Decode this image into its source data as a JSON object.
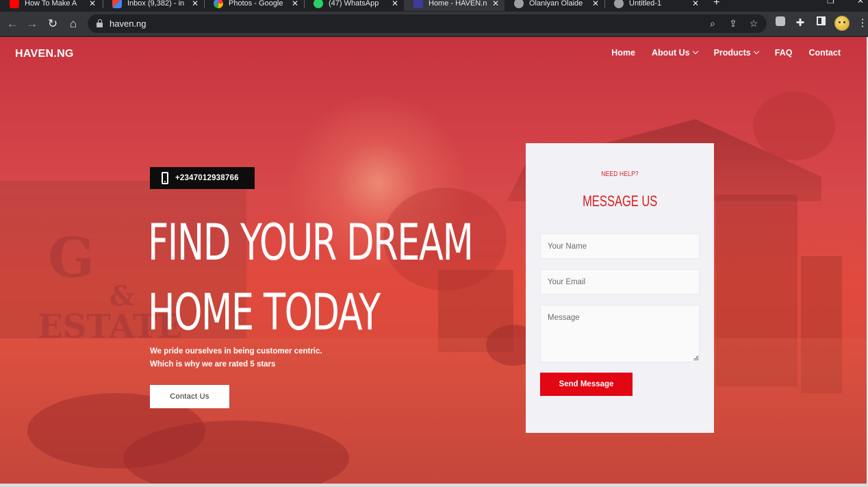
{
  "browser": {
    "tabs": [
      {
        "label": "How To Make A",
        "icon": "youtube-icon",
        "color": "#ff0000"
      },
      {
        "label": "Inbox (9,382) - in",
        "icon": "gmail-icon",
        "color": "#ea4335"
      },
      {
        "label": "Photos - Google",
        "icon": "google-photos-icon",
        "color": "#fbbc04"
      },
      {
        "label": "(47) WhatsApp",
        "icon": "whatsapp-icon",
        "color": "#25d366"
      },
      {
        "label": "Home - HAVEN.n",
        "icon": "haven-icon",
        "color": "#3b3b9a"
      },
      {
        "label": "Olaniyan Olaide",
        "icon": "globe-icon",
        "color": "#9aa0a6"
      },
      {
        "label": "Untitled-1",
        "icon": "globe-icon",
        "color": "#9aa0a6"
      }
    ],
    "active_tab": 4,
    "url": "haven.ng"
  },
  "site": {
    "brand": "HAVEN.NG",
    "nav": [
      {
        "label": "Home",
        "dropdown": false
      },
      {
        "label": "About Us",
        "dropdown": true
      },
      {
        "label": "Products",
        "dropdown": true
      },
      {
        "label": "FAQ",
        "dropdown": false
      },
      {
        "label": "Contact",
        "dropdown": false
      }
    ],
    "accent": "#e30613",
    "overlay_color": "#d9423e"
  },
  "hero": {
    "phone": "+2347012938766",
    "title_line1": "FIND YOUR DREAM",
    "title_line2": "HOME TODAY",
    "sub_line1": "We pride ourselves in being customer centric.",
    "sub_line2": "Which is why we are rated 5 stars",
    "cta": "Contact Us"
  },
  "form": {
    "kicker": "NEED HELP?",
    "title": "MESSAGE US",
    "name_placeholder": "Your Name",
    "email_placeholder": "Your Email",
    "message_placeholder": "Message",
    "submit": "Send Message"
  }
}
